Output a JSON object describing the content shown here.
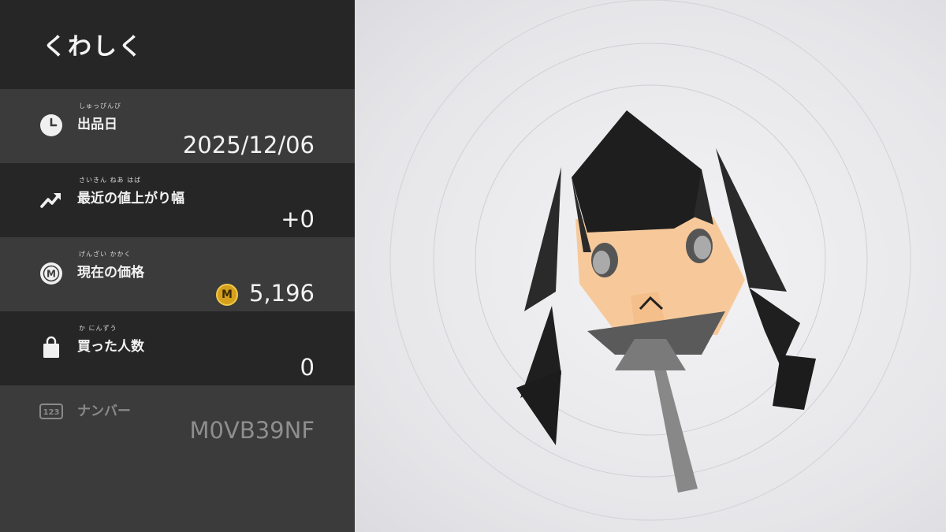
{
  "header": {
    "title": "くわしく"
  },
  "rows": [
    {
      "ruby": "しゅっぴんび",
      "label": "出品日",
      "value": "2025/12/06",
      "icon": "clock-icon"
    },
    {
      "ruby": "さいきん ねあ はば",
      "label": "最近の値上がり幅",
      "value": "+0",
      "icon": "trend-up-icon"
    },
    {
      "ruby": "げんざい かかく",
      "label": "現在の価格",
      "value": "5,196",
      "icon": "coin-m-icon",
      "coin_letter": "M"
    },
    {
      "ruby": "か にんずう",
      "label": "買った人数",
      "value": "0",
      "icon": "shopping-bag-icon"
    }
  ],
  "number": {
    "badge": "123",
    "label": "ナンバー",
    "value": "M0VB39NF"
  },
  "colors": {
    "panel_dark": "#262626",
    "panel_light": "#3b3b3b",
    "coin": "#d6a01c",
    "hair": "#1e1e1e",
    "skin": "#f7c99a"
  }
}
